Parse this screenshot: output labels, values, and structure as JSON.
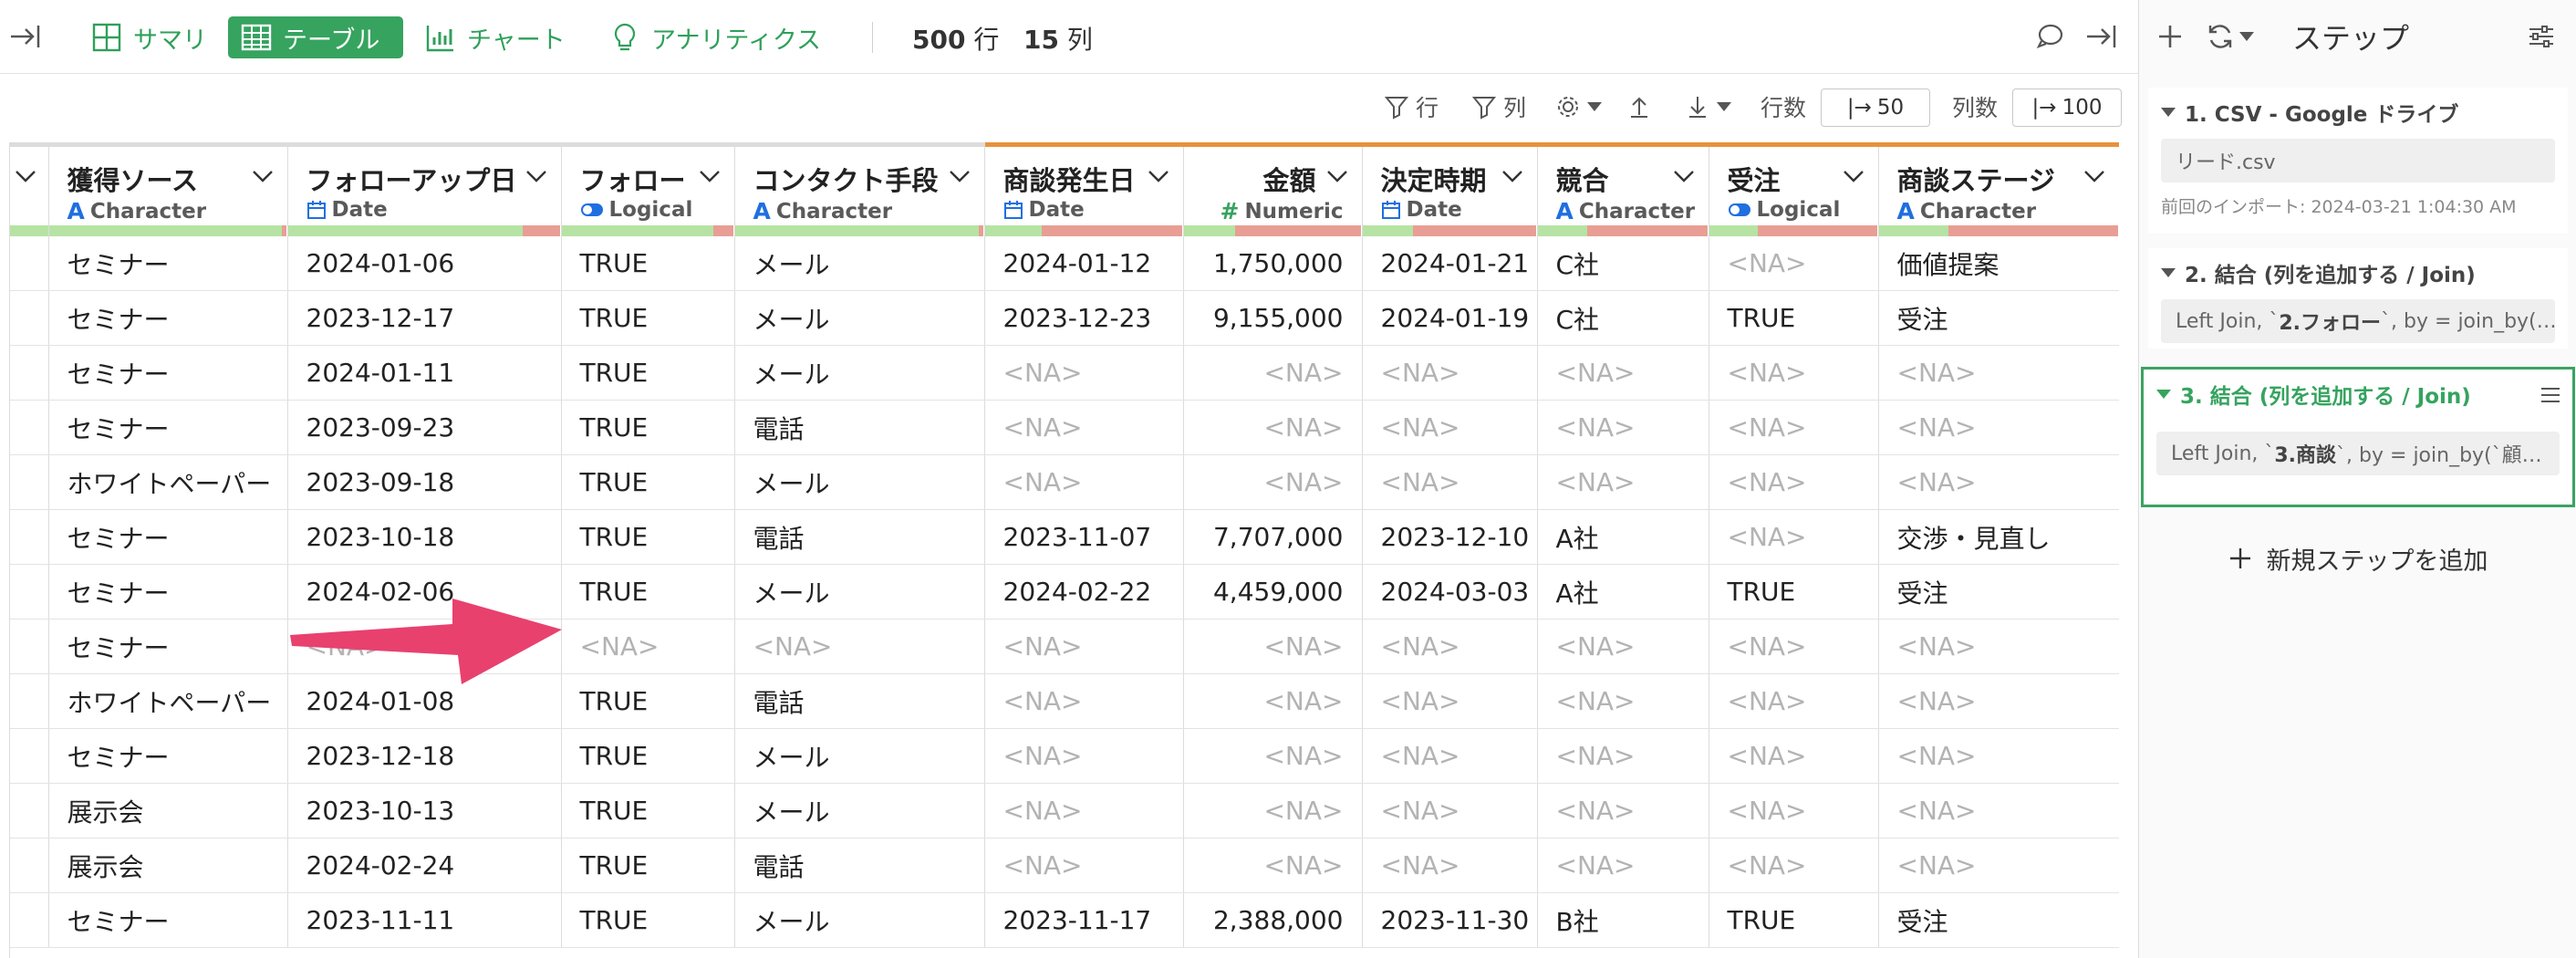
{
  "toolbar": {
    "views": [
      {
        "label": "サマリ",
        "icon": "summary-grid-icon"
      },
      {
        "label": "テーブル",
        "icon": "table-icon",
        "active": true
      },
      {
        "label": "チャート",
        "icon": "bar-chart-icon"
      },
      {
        "label": "アナリティクス",
        "icon": "lightbulb-icon"
      }
    ],
    "rows_count": "500",
    "rows_unit": "行",
    "cols_count": "15",
    "cols_unit": "列"
  },
  "subtoolbar": {
    "row_filter": "行",
    "col_filter": "列",
    "row_count_label": "行数",
    "row_count_value": "50",
    "col_count_label": "列数",
    "col_count_value": "100"
  },
  "table": {
    "columns": [
      {
        "name": "獲得ソース",
        "type": "Character",
        "type_icon": "A",
        "align": "left",
        "highlight": false
      },
      {
        "name": "フォローアップ日",
        "type": "Date",
        "type_icon": "calendar",
        "align": "left",
        "highlight": false
      },
      {
        "name": "フォロー",
        "type": "Logical",
        "type_icon": "toggle",
        "align": "left",
        "highlight": false
      },
      {
        "name": "コンタクト手段",
        "type": "Character",
        "type_icon": "A",
        "align": "left",
        "highlight": false
      },
      {
        "name": "商談発生日",
        "type": "Date",
        "type_icon": "calendar",
        "align": "left",
        "highlight": true
      },
      {
        "name": "金額",
        "type": "Numeric",
        "type_icon": "#",
        "align": "right",
        "highlight": true
      },
      {
        "name": "決定時期",
        "type": "Date",
        "type_icon": "calendar",
        "align": "left",
        "highlight": true
      },
      {
        "name": "競合",
        "type": "Character",
        "type_icon": "A",
        "align": "left",
        "highlight": true
      },
      {
        "name": "受注",
        "type": "Logical",
        "type_icon": "toggle",
        "align": "left",
        "highlight": true
      },
      {
        "name": "商談ステージ",
        "type": "Character",
        "type_icon": "A",
        "align": "left",
        "highlight": true
      }
    ],
    "quality": [
      0.98,
      0.86,
      0.88,
      0.98,
      0.29,
      0.29,
      0.29,
      0.29,
      0.29,
      0.29
    ],
    "rows": [
      [
        "セミナー",
        "2024-01-06",
        "TRUE",
        "メール",
        "2024-01-12",
        "1,750,000",
        "2024-01-21",
        "C社",
        "<NA>",
        "価値提案"
      ],
      [
        "セミナー",
        "2023-12-17",
        "TRUE",
        "メール",
        "2023-12-23",
        "9,155,000",
        "2024-01-19",
        "C社",
        "TRUE",
        "受注"
      ],
      [
        "セミナー",
        "2024-01-11",
        "TRUE",
        "メール",
        "<NA>",
        "<NA>",
        "<NA>",
        "<NA>",
        "<NA>",
        "<NA>"
      ],
      [
        "セミナー",
        "2023-09-23",
        "TRUE",
        "電話",
        "<NA>",
        "<NA>",
        "<NA>",
        "<NA>",
        "<NA>",
        "<NA>"
      ],
      [
        "ホワイトペーパー",
        "2023-09-18",
        "TRUE",
        "メール",
        "<NA>",
        "<NA>",
        "<NA>",
        "<NA>",
        "<NA>",
        "<NA>"
      ],
      [
        "セミナー",
        "2023-10-18",
        "TRUE",
        "電話",
        "2023-11-07",
        "7,707,000",
        "2023-12-10",
        "A社",
        "<NA>",
        "交渉・見直し"
      ],
      [
        "セミナー",
        "2024-02-06",
        "TRUE",
        "メール",
        "2024-02-22",
        "4,459,000",
        "2024-03-03",
        "A社",
        "TRUE",
        "受注"
      ],
      [
        "セミナー",
        "<NA>",
        "<NA>",
        "<NA>",
        "<NA>",
        "<NA>",
        "<NA>",
        "<NA>",
        "<NA>",
        "<NA>"
      ],
      [
        "ホワイトペーパー",
        "2024-01-08",
        "TRUE",
        "電話",
        "<NA>",
        "<NA>",
        "<NA>",
        "<NA>",
        "<NA>",
        "<NA>"
      ],
      [
        "セミナー",
        "2023-12-18",
        "TRUE",
        "メール",
        "<NA>",
        "<NA>",
        "<NA>",
        "<NA>",
        "<NA>",
        "<NA>"
      ],
      [
        "展示会",
        "2023-10-13",
        "TRUE",
        "メール",
        "<NA>",
        "<NA>",
        "<NA>",
        "<NA>",
        "<NA>",
        "<NA>"
      ],
      [
        "展示会",
        "2024-02-24",
        "TRUE",
        "電話",
        "<NA>",
        "<NA>",
        "<NA>",
        "<NA>",
        "<NA>",
        "<NA>"
      ],
      [
        "セミナー",
        "2023-11-11",
        "TRUE",
        "メール",
        "2023-11-17",
        "2,388,000",
        "2023-11-30",
        "B社",
        "TRUE",
        "受注"
      ]
    ]
  },
  "annotation": {
    "arrow_color": "#e8416e"
  },
  "panel": {
    "title": "ステップ",
    "steps": [
      {
        "title": "1. CSV - Google ドライブ",
        "box": "リード.csv",
        "sub": "前回のインポート: 2024-03-21 1:04:30 AM",
        "active": false
      },
      {
        "title": "2. 結合 (列を追加する / Join)",
        "box_pre": "Left Join, `",
        "box_bold": "2.フォロー",
        "box_post": "`, by = join_by(…",
        "active": false
      },
      {
        "title": "3. 結合 (列を追加する / Join)",
        "box_pre": "Left Join, `",
        "box_bold": "3.商談",
        "box_post": "`, by = join_by(`顧…",
        "active": true
      }
    ],
    "add_step_label": "新規ステップを追加"
  },
  "colors": {
    "accent": "#36a35f",
    "highlight_header": "#e8913c",
    "na_text": "#b3b3b3",
    "quality_ok": "#b6e3a4",
    "quality_na": "#e89e94"
  }
}
